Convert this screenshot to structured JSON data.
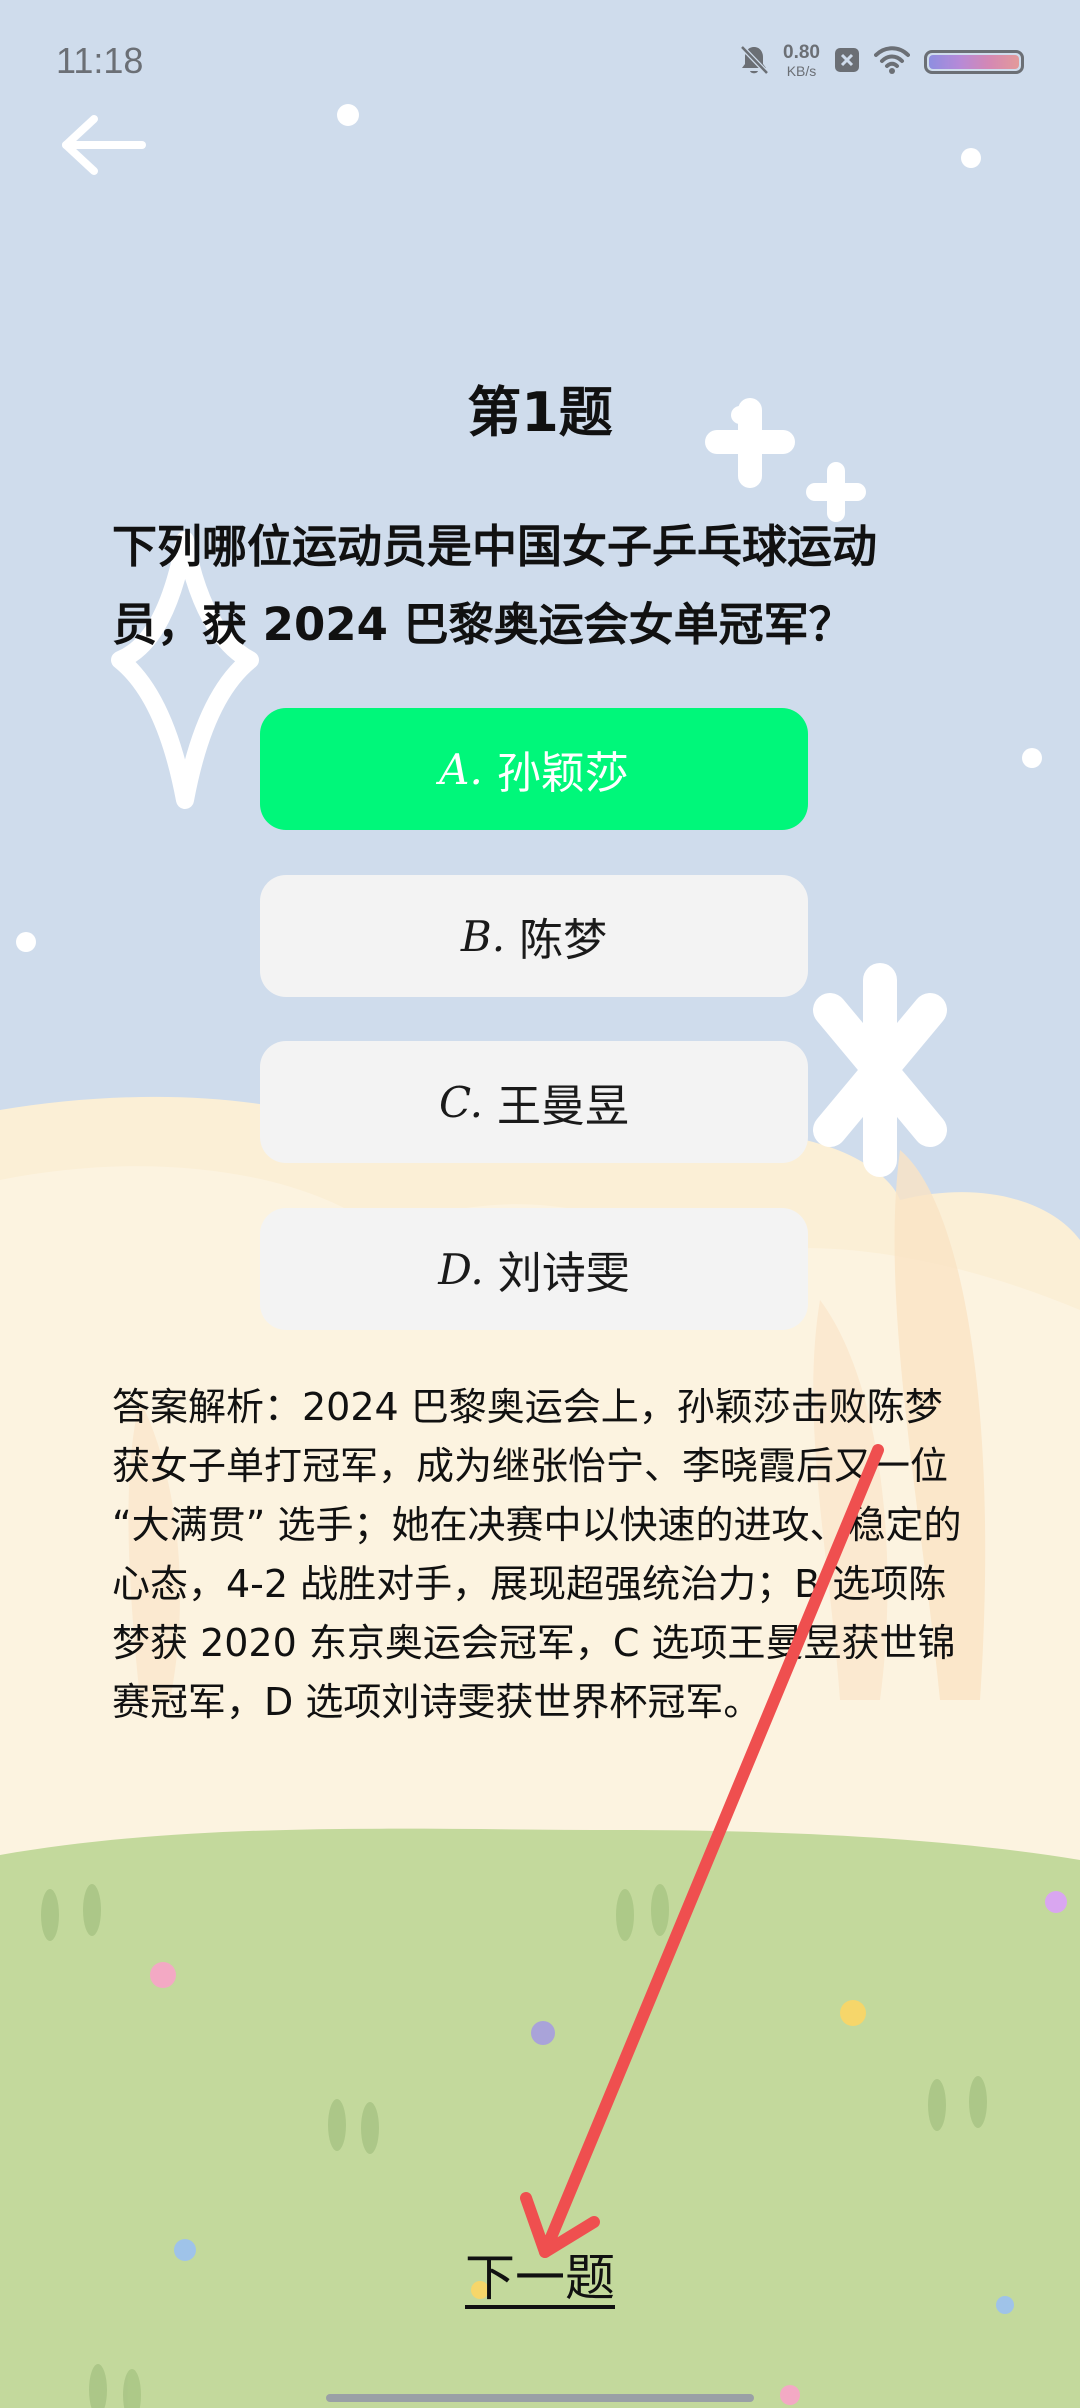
{
  "status_bar": {
    "time": "11:18",
    "net_speed_value": "0.80",
    "net_speed_unit": "KB/s",
    "icons": [
      "mute-bell-icon",
      "close-box-icon",
      "wifi-icon",
      "battery-icon"
    ]
  },
  "header": {
    "back_icon": "arrow-left-icon"
  },
  "question": {
    "number": "第1题",
    "text": "下列哪位运动员是中国女子乒乓球运动员，获 2024 巴黎奥运会女单冠军？"
  },
  "options": [
    {
      "letter": "A.",
      "label": "孙颖莎",
      "state": "correct"
    },
    {
      "letter": "B.",
      "label": "陈梦",
      "state": "normal"
    },
    {
      "letter": "C.",
      "label": "王曼昱",
      "state": "normal"
    },
    {
      "letter": "D.",
      "label": "刘诗雯",
      "state": "normal"
    }
  ],
  "explanation": "答案解析：2024 巴黎奥运会上，孙颖莎击败陈梦获女子单打冠军，成为继张怡宁、李晓霞后又一位 “大满贯” 选手；她在决赛中以快速的进攻、稳定的心态，4-2 战胜对手，展现超强统治力；B 选项陈梦获 2020 东京奥运会冠军，C 选项王曼昱获世锦赛冠军，D 选项刘诗雯获世界杯冠军。",
  "next_button": "下一题",
  "colors": {
    "correct_option": "#00f77a",
    "option_bg": "#f3f3f3",
    "sky": "#cfdcec",
    "grass": "#c3d99c",
    "annotation_arrow": "#ef4f4f"
  }
}
